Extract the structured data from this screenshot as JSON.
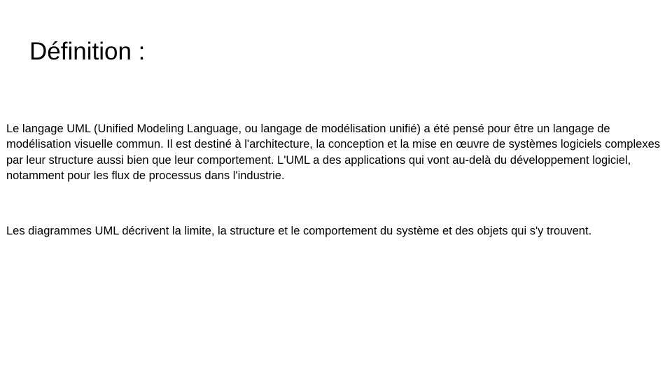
{
  "slide": {
    "title": "Définition :",
    "paragraphs": [
      "Le langage UML (Unified Modeling Language, ou langage de modélisation unifié) a été pensé pour être un langage de modélisation visuelle commun. Il est destiné à l'architecture, la conception et la mise en œuvre de systèmes logiciels complexes par leur structure aussi bien que leur comportement. L'UML a des applications qui vont au-delà du développement logiciel, notamment pour les flux de processus dans l'industrie.",
      "Les diagrammes UML décrivent la limite, la structure et le comportement du système et des objets qui s'y trouvent."
    ]
  }
}
